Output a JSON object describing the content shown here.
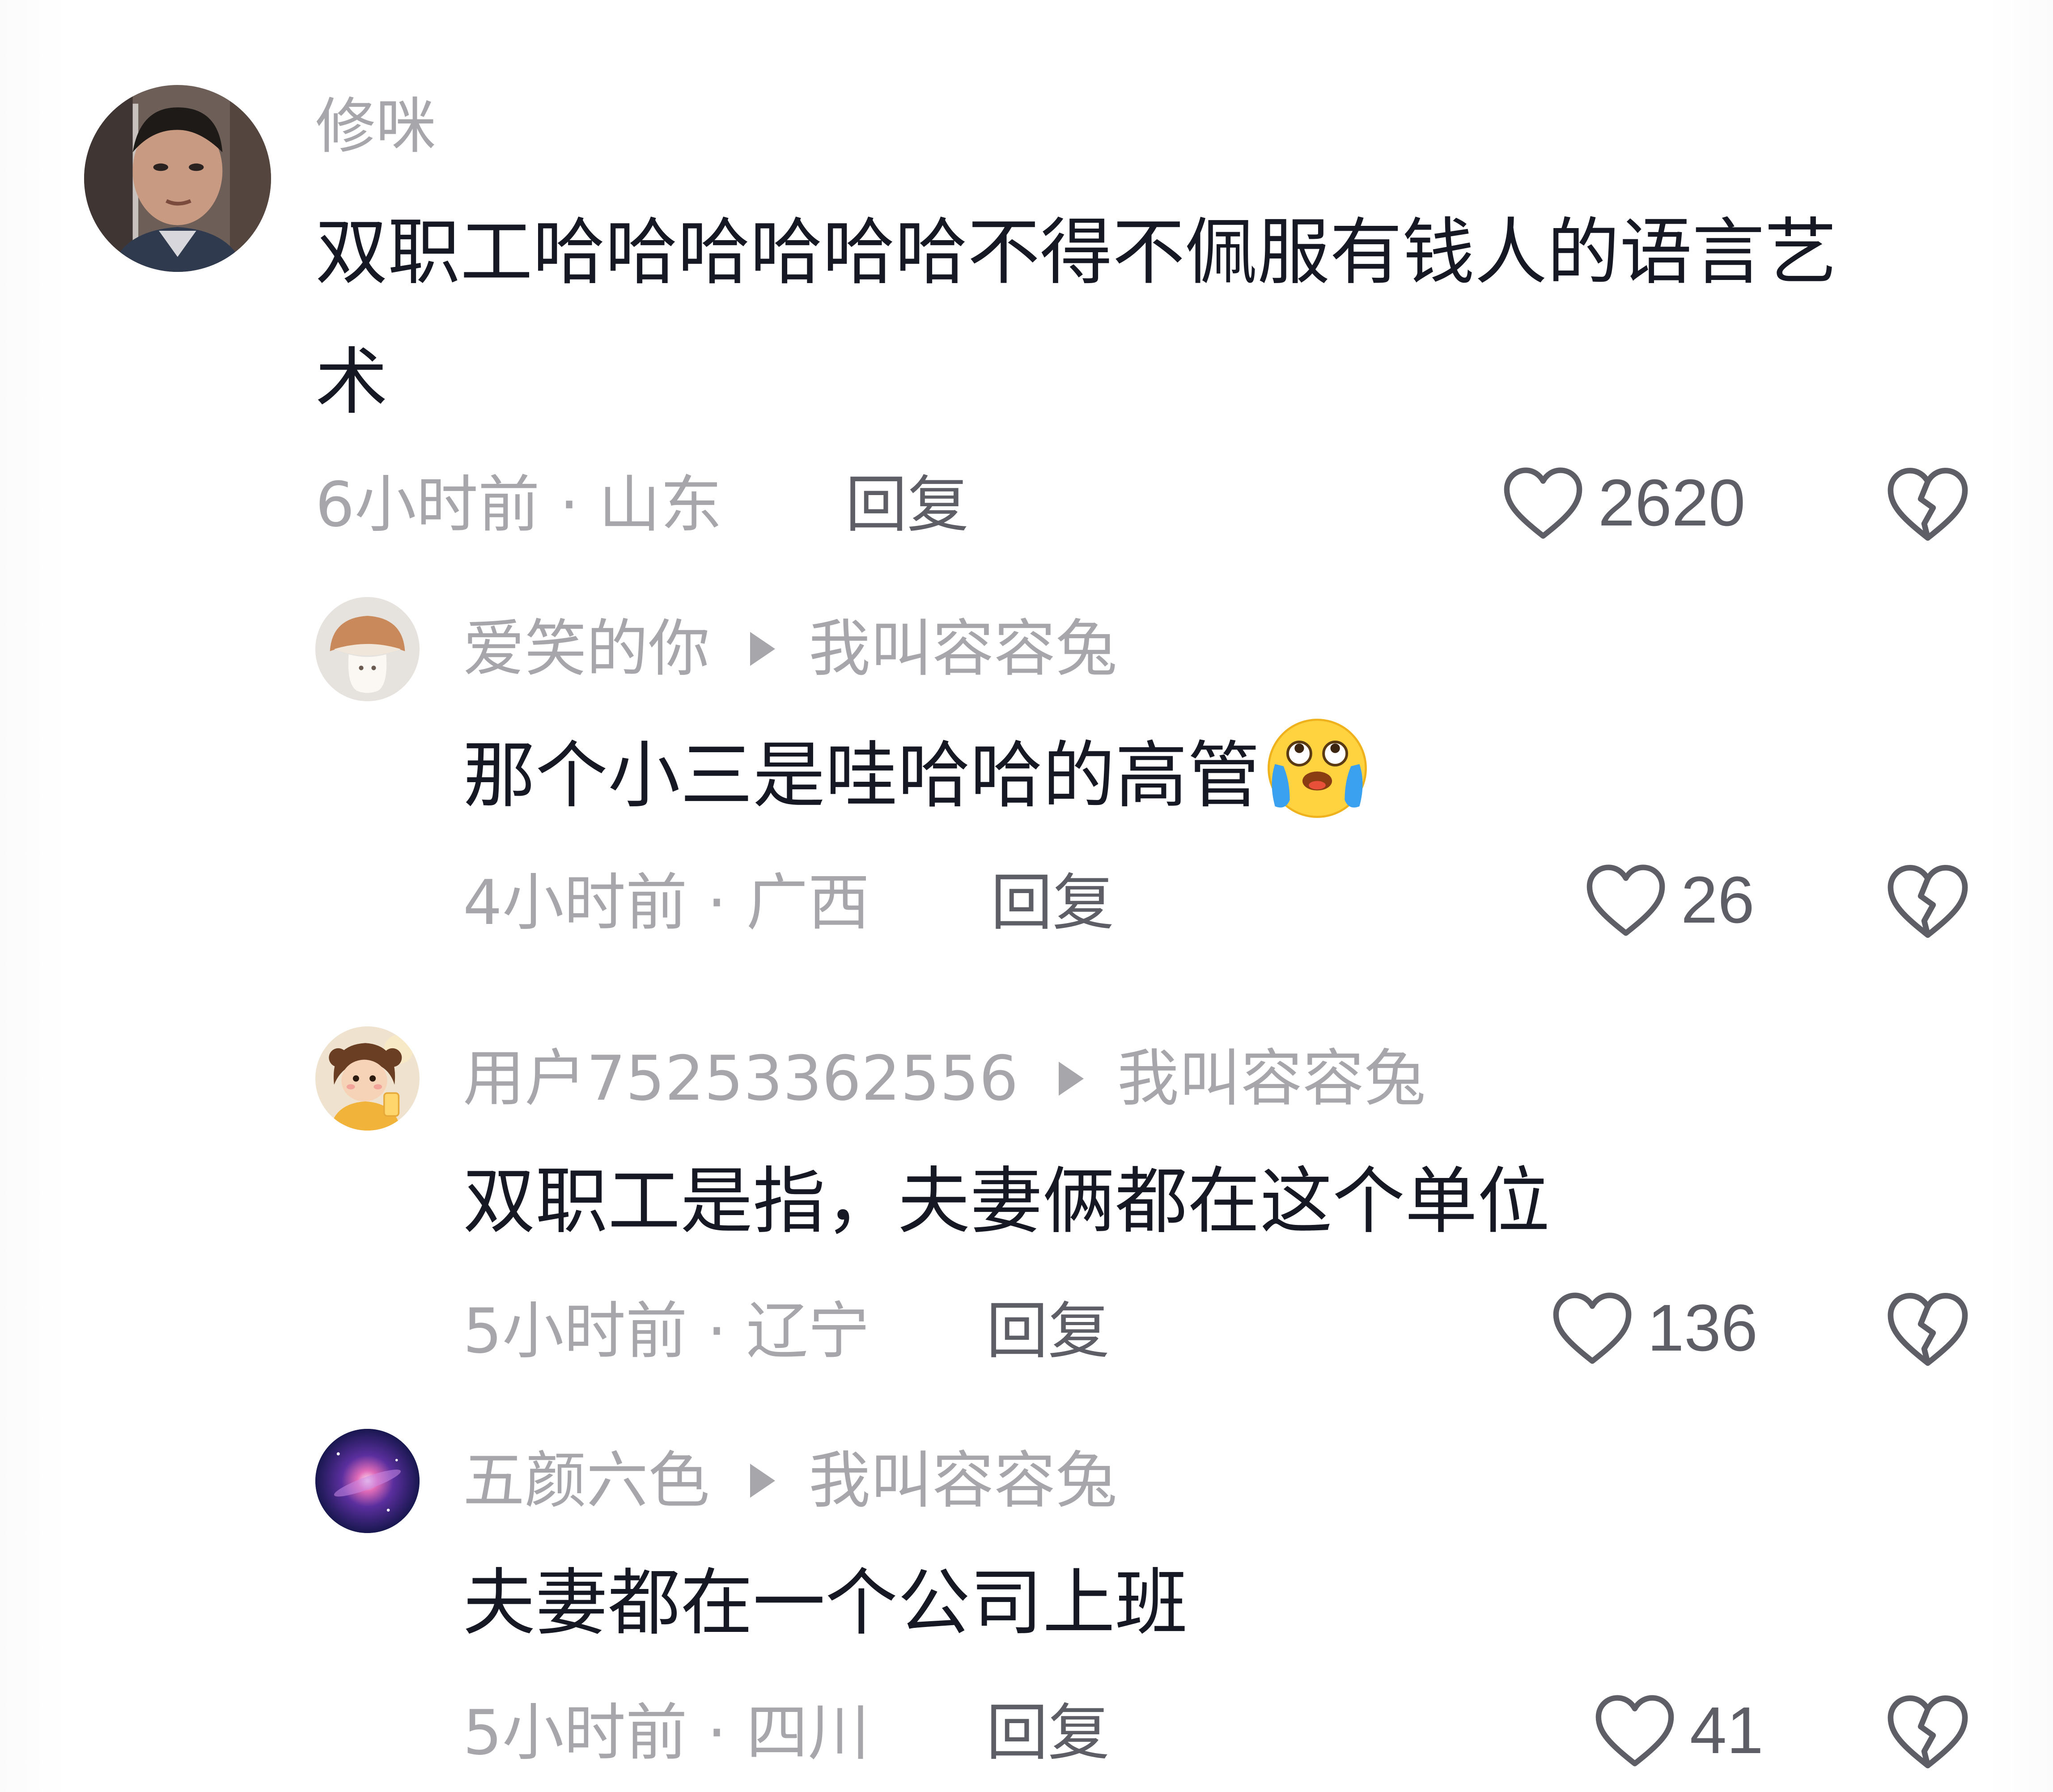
{
  "comments": [
    {
      "username": "修咪",
      "text_line1": "双职工哈哈哈哈哈哈不得不佩服有钱人的语言艺",
      "text_line2": "术",
      "meta": "6小时前 · 山东",
      "reply_label": "回复",
      "likes": "2620",
      "avatar_icon": "user-photo-avatar"
    }
  ],
  "replies": [
    {
      "username": "爱笑的你",
      "reply_to": "我叫容容兔",
      "text": "那个小三是哇哈哈的高管",
      "emoji": "crying-laughing-emoji",
      "meta": "4小时前 · 广西",
      "reply_label": "回复",
      "likes": "26",
      "avatar_icon": "mushroom-avatar"
    },
    {
      "username": "用户75253362556",
      "reply_to": "我叫容容兔",
      "text": "双职工是指，夫妻俩都在这个单位",
      "meta": "5小时前 · 辽宁",
      "reply_label": "回复",
      "likes": "136",
      "avatar_icon": "girl-avatar"
    },
    {
      "username": "五颜六色",
      "reply_to": "我叫容容兔",
      "text": "夫妻都在一个公司上班",
      "meta": "5小时前 · 四川",
      "reply_label": "回复",
      "likes": "41",
      "avatar_icon": "galaxy-avatar"
    }
  ],
  "colors": {
    "primary_text": "#161823",
    "secondary_text": "#a7a7ab",
    "action_text": "#5d5e66",
    "background": "#ffffff"
  }
}
